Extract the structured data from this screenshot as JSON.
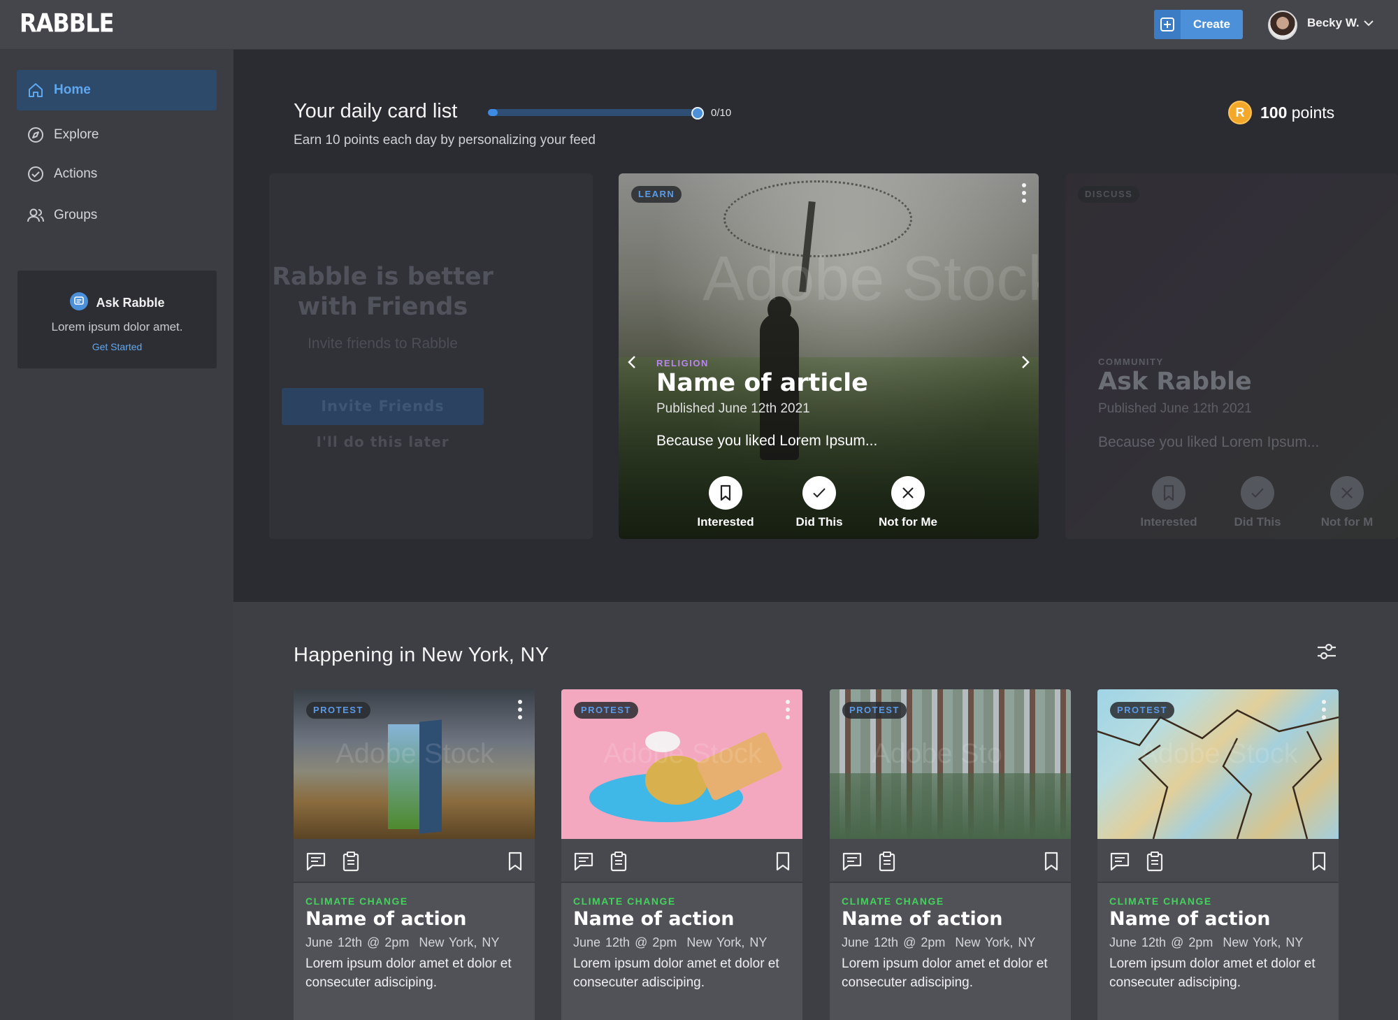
{
  "app": {
    "logo": "RABBLE"
  },
  "header": {
    "create_label": "Create",
    "user_name": "Becky W."
  },
  "sidebar": {
    "items": [
      {
        "label": "Home",
        "icon": "home-icon",
        "active": true
      },
      {
        "label": "Explore",
        "icon": "compass-icon",
        "active": false
      },
      {
        "label": "Actions",
        "icon": "check-circle-icon",
        "active": false
      },
      {
        "label": "Groups",
        "icon": "users-icon",
        "active": false
      }
    ],
    "ask": {
      "title": "Ask Rabble",
      "subtitle": "Lorem ipsum dolor amet.",
      "link": "Get Started"
    }
  },
  "daily": {
    "title": "Your daily card list",
    "progress_text": "0/10",
    "progress_fraction": 0.0,
    "subtitle": "Earn 10 points each day by personalizing your feed",
    "points_coin": "R",
    "points_value": "100",
    "points_unit": "points"
  },
  "cards": {
    "left": {
      "title_line1": "Rabble is better",
      "title_line2": "with Friends",
      "subtitle": "Invite friends to Rabble",
      "button": "Invite Friends",
      "later": "I'll do this later"
    },
    "main": {
      "badge": "LEARN",
      "category": "RELIGION",
      "title": "Name of article",
      "published": "Published June 12th 2021",
      "because": "Because you liked Lorem Ipsum...",
      "watermark": "Adobe Stock",
      "actions": [
        "Interested",
        "Did This",
        "Not for Me"
      ]
    },
    "right": {
      "badge": "DISCUSS",
      "category": "COMMUNITY",
      "title": "Ask Rabble",
      "published": "Published June 12th 2021",
      "because": "Because you liked Lorem Ipsum...",
      "actions": [
        "Interested",
        "Did This",
        "Not for M"
      ]
    }
  },
  "happening": {
    "title": "Happening in New York, NY",
    "events": [
      {
        "badge": "PROTEST",
        "category": "CLIMATE CHANGE",
        "title": "Name of action",
        "date": "June 12th @ 2pm",
        "location": "New York, NY",
        "desc": "Lorem ipsum dolor amet et dolor et consecuter adisciping.",
        "watermark": "Adobe Stock"
      },
      {
        "badge": "PROTEST",
        "category": "CLIMATE CHANGE",
        "title": "Name of action",
        "date": "June 12th @ 2pm",
        "location": "New York, NY",
        "desc": "Lorem ipsum dolor amet et dolor et consecuter adisciping.",
        "watermark": "Adobe Stock"
      },
      {
        "badge": "PROTEST",
        "category": "CLIMATE CHANGE",
        "title": "Name of action",
        "date": "June 12th @ 2pm",
        "location": "New York, NY",
        "desc": "Lorem ipsum dolor amet et dolor et consecuter adisciping.",
        "watermark": "Adobe Sto"
      },
      {
        "badge": "PROTEST",
        "category": "CLIMATE CHANGE",
        "title": "Name of action",
        "date": "June 12th @ 2pm",
        "location": "New York, NY",
        "desc": "Lorem ipsum dolor amet et dolor et consecuter adisciping.",
        "watermark": "Adobe Stock"
      }
    ]
  },
  "colors": {
    "accent": "#4b90d8",
    "nav_active": "#5fa8f0",
    "climate": "#43d35c",
    "religion": "#b985ef",
    "coin": "#f3a82a"
  }
}
